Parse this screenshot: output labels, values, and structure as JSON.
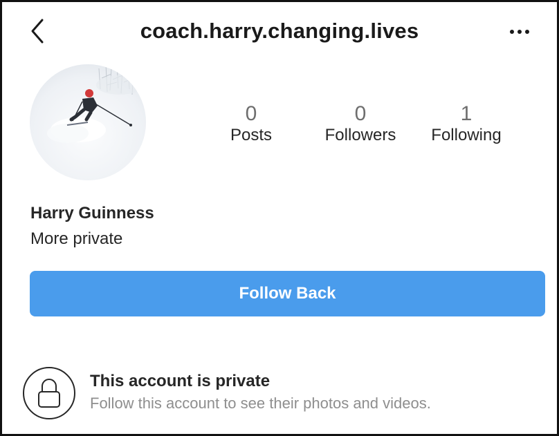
{
  "header": {
    "username": "coach.harry.changing.lives",
    "back_icon": "chevron-left-icon",
    "more_icon": "more-horizontal-icon"
  },
  "profile": {
    "avatar": "skier-in-snow-photo",
    "stats": [
      {
        "value": "0",
        "label": "Posts"
      },
      {
        "value": "0",
        "label": "Followers"
      },
      {
        "value": "1",
        "label": "Following"
      }
    ],
    "display_name": "Harry Guinness",
    "bio": "More private"
  },
  "actions": {
    "follow_back_label": "Follow Back"
  },
  "private_notice": {
    "icon": "lock-icon",
    "title": "This account is private",
    "subtitle": "Follow this account to see their photos and videos."
  },
  "colors": {
    "accent": "#4a9cec",
    "text": "#262626",
    "muted": "#8e8e8e"
  }
}
